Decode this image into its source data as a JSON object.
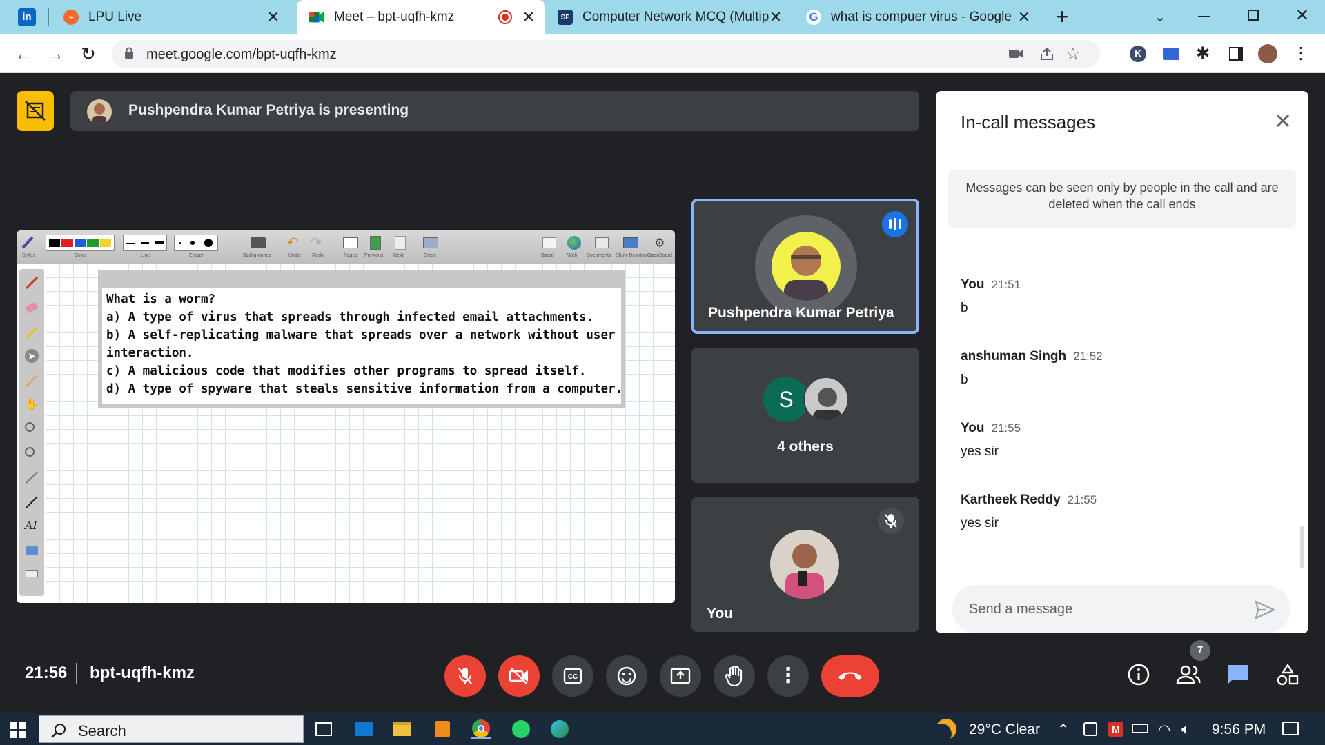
{
  "browser": {
    "tabs": [
      {
        "title": "LPU Live",
        "icon": "lpu-icon"
      },
      {
        "title": "Meet – bpt-uqfh-kmz",
        "icon": "meet-icon",
        "active": true,
        "recording": true
      },
      {
        "title": "Computer Network MCQ (Multip",
        "icon": "sanfoundry-icon"
      },
      {
        "title": "what is compuer virus - Google S",
        "icon": "google-icon"
      }
    ],
    "url": "meet.google.com/bpt-uqfh-kmz"
  },
  "meet": {
    "presenting_text": "Pushpendra Kumar Petriya is presenting",
    "board": {
      "lines": [
        "What is a worm?",
        "a) A type of virus that spreads through infected email attachments.",
        "b) A self-replicating malware that spreads over a network without user",
        "interaction.",
        "c) A malicious code that modifies other programs to spread itself.",
        "d) A type of spyware that steals sensitive information from a computer."
      ],
      "toolbar_labels": [
        "Stylus",
        "Color",
        "Line",
        "Eraser",
        "Backgrounds",
        "Undo",
        "Redo",
        "Pages",
        "Previous",
        "Next",
        "Erase",
        "Board",
        "Web",
        "Documents",
        "Show Desktop",
        "OpenBoard"
      ]
    },
    "participants": {
      "presenter": "Pushpendra Kumar Petriya",
      "others_initial": "S",
      "others_label": "4 others",
      "self_label": "You"
    },
    "chat": {
      "title": "In-call messages",
      "notice": "Messages can be seen only by people in the call and are deleted when the call ends",
      "messages": [
        {
          "sender": "You",
          "time": "21:51",
          "text": "b"
        },
        {
          "sender": "anshuman Singh",
          "time": "21:52",
          "text": "b"
        },
        {
          "sender": "You",
          "time": "21:55",
          "text": "yes sir"
        },
        {
          "sender": "Kartheek Reddy",
          "time": "21:55",
          "text": "yes sir"
        }
      ],
      "input_placeholder": "Send a message"
    },
    "bottom": {
      "time": "21:56",
      "meeting_code": "bpt-uqfh-kmz",
      "people_count": "7"
    }
  },
  "taskbar": {
    "search_label": "Search",
    "weather": "29°C  Clear",
    "clock": "9:56 PM"
  },
  "colors": {
    "meet_bg": "#202124",
    "tile_bg": "#3c4043",
    "danger": "#ea4335",
    "accent": "#8ab4f8",
    "present_yellow": "#fbbc04",
    "tabstrip": "#9dd9ea"
  }
}
